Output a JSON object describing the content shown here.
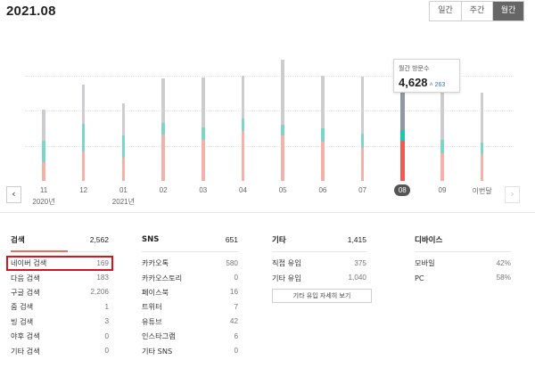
{
  "title": "2021.08",
  "period_tabs": [
    "일간",
    "주간",
    "월간"
  ],
  "active_tab": 2,
  "colors": {
    "gray": "#cdcdcf",
    "teal": "#7fd4c8",
    "pink": "#f4b1a8",
    "selected_gray": "#8e98a6",
    "selected_teal": "#1ec5ad",
    "selected_red": "#f05a56"
  },
  "chart_data": {
    "type": "bar",
    "categories": [
      "11",
      "12",
      "01",
      "02",
      "03",
      "04",
      "05",
      "06",
      "07",
      "08",
      "09",
      "이번달"
    ],
    "year_labels": {
      "0": "2020년",
      "2": "2021년"
    },
    "selected_index": 9,
    "series": [
      {
        "values": [
          1210,
          1530,
          1230,
          1750,
          1930,
          1670,
          2520,
          2040,
          2200,
          2680,
          1980,
          1930
        ]
      },
      {
        "values": [
          820,
          1070,
          890,
          450,
          480,
          480,
          420,
          520,
          540,
          400,
          520,
          460
        ]
      },
      {
        "values": [
          720,
          1130,
          880,
          1780,
          1600,
          1930,
          1760,
          1520,
          1280,
          1550,
          1080,
          1030
        ]
      }
    ],
    "ylim": [
      0,
      5000
    ],
    "grid": true
  },
  "tooltip": {
    "label": "월간 방문수",
    "value": "4,628",
    "change": "˄ 263"
  },
  "columns": [
    {
      "title": "검색",
      "count": "2,562",
      "rows": [
        [
          "네이버 검색",
          "169"
        ],
        [
          "다음 검색",
          "183"
        ],
        [
          "구글 검색",
          "2,206"
        ],
        [
          "줌 검색",
          "1"
        ],
        [
          "빙 검색",
          "3"
        ],
        [
          "야후 검색",
          "0"
        ],
        [
          "기타 검색",
          "0"
        ]
      ]
    },
    {
      "title": "SNS",
      "count": "651",
      "rows": [
        [
          "카카오톡",
          "580"
        ],
        [
          "카카오스토리",
          "0"
        ],
        [
          "페이스북",
          "16"
        ],
        [
          "트위터",
          "7"
        ],
        [
          "유튜브",
          "42"
        ],
        [
          "인스타그램",
          "6"
        ],
        [
          "기타 SNS",
          "0"
        ]
      ]
    },
    {
      "title": "기타",
      "count": "1,415",
      "rows": [
        [
          "직접 유입",
          "375"
        ],
        [
          "기타 유입",
          "1,040"
        ]
      ],
      "button": "기타 유입 자세히 보기"
    },
    {
      "title": "디바이스",
      "count": "",
      "rows": [
        [
          "모바일",
          "42%"
        ],
        [
          "PC",
          "58%"
        ]
      ]
    }
  ],
  "nav": {
    "prev": "‹",
    "next": "›"
  }
}
